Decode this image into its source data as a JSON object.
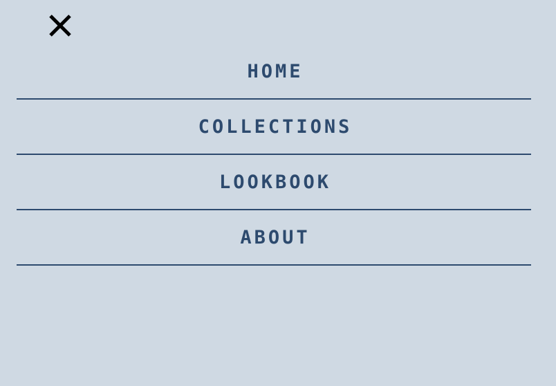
{
  "nav": {
    "close_icon": "close-icon",
    "items": [
      {
        "label": "HOME"
      },
      {
        "label": "COLLECTIONS"
      },
      {
        "label": "LOOKBOOK"
      },
      {
        "label": "ABOUT"
      }
    ]
  },
  "colors": {
    "background": "#cfd9e3",
    "text": "#2d4a6e",
    "divider": "#2d4a6e",
    "close_icon": "#000000"
  }
}
